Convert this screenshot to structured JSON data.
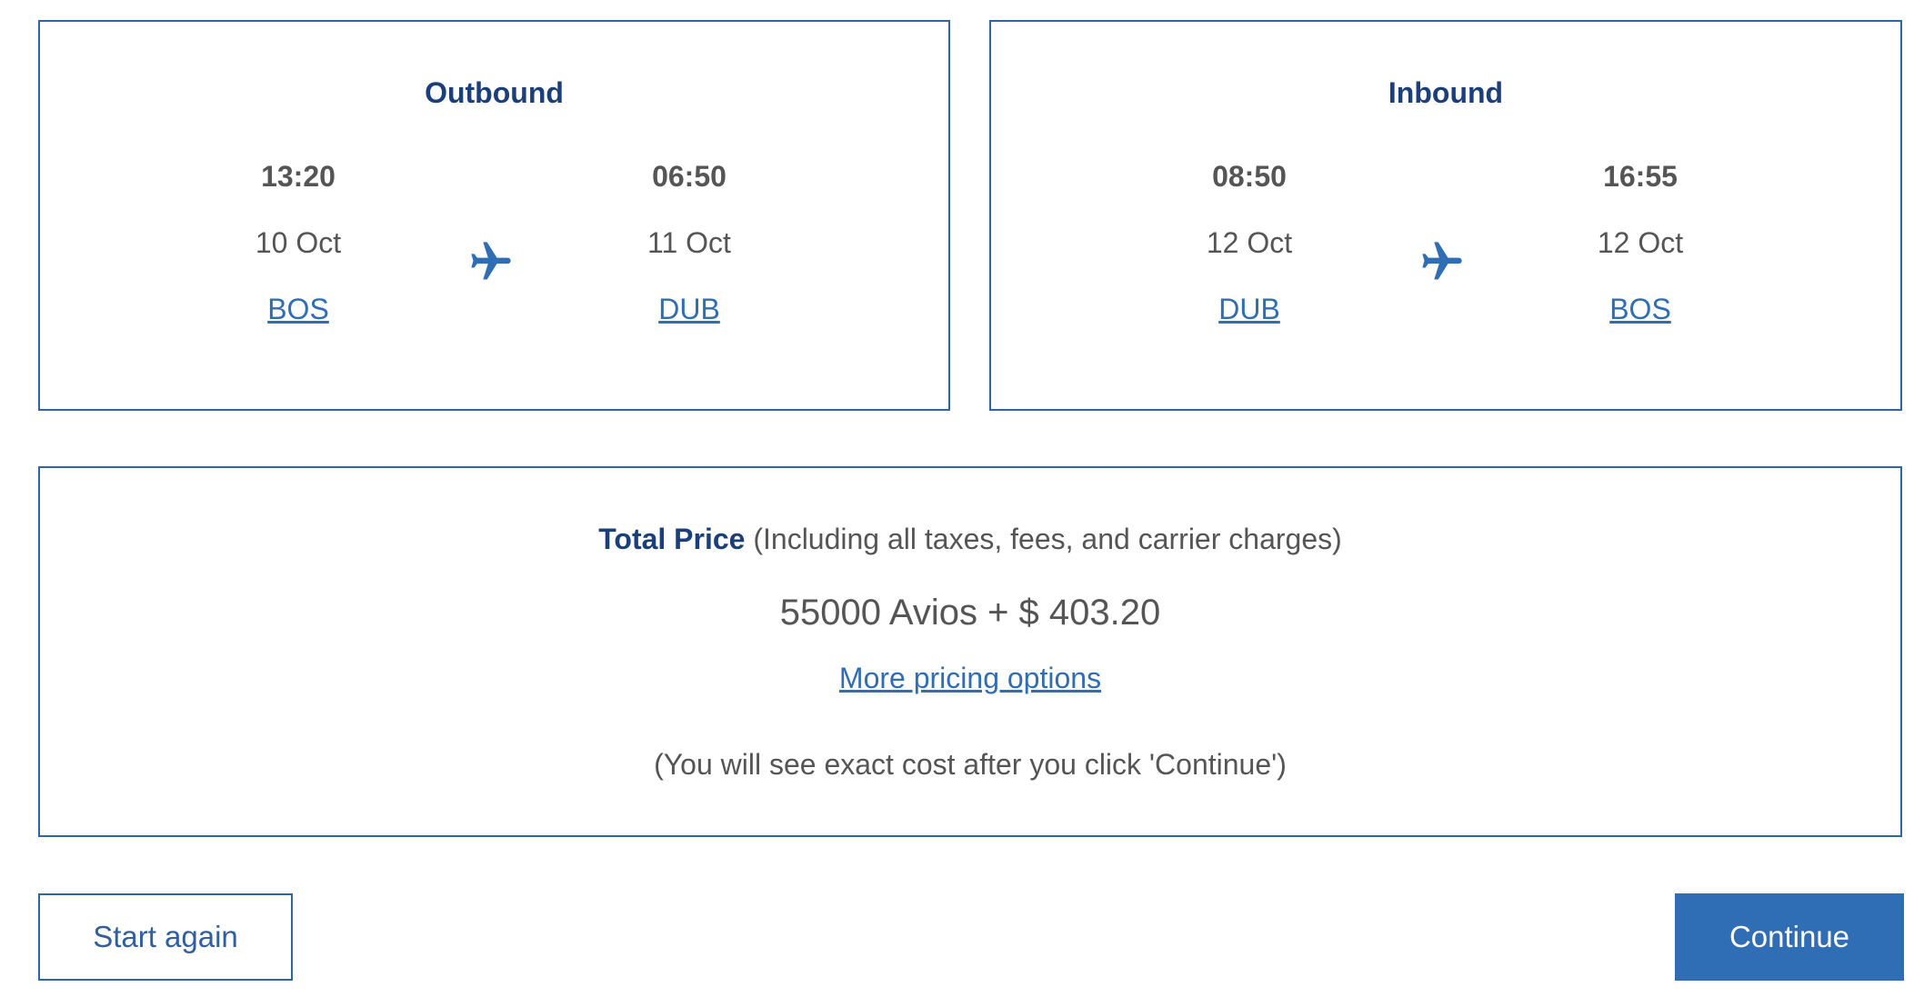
{
  "outbound": {
    "title": "Outbound",
    "departure": {
      "time": "13:20",
      "date": "10 Oct",
      "airport": "BOS"
    },
    "arrival": {
      "time": "06:50",
      "date": "11 Oct",
      "airport": "DUB"
    }
  },
  "inbound": {
    "title": "Inbound",
    "departure": {
      "time": "08:50",
      "date": "12 Oct",
      "airport": "DUB"
    },
    "arrival": {
      "time": "16:55",
      "date": "12 Oct",
      "airport": "BOS"
    }
  },
  "price": {
    "label": "Total Price",
    "qualifier": " (Including all taxes, fees, and carrier charges)",
    "amount": "55000 Avios + $ 403.20",
    "more_link": "More pricing options",
    "note": "(You will see exact cost after you click 'Continue')"
  },
  "buttons": {
    "start_again": "Start again",
    "continue": "Continue"
  },
  "icons": {
    "flight": "airplane-icon"
  },
  "colors": {
    "brand_blue": "#2f6db5",
    "heading_navy": "#1b3f7a",
    "border_blue": "#2f65a7"
  }
}
